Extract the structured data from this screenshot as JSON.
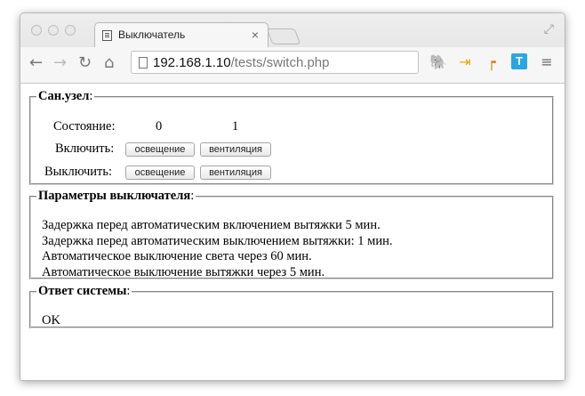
{
  "browser": {
    "tab_title": "Выключатель",
    "tab_close": "×",
    "url_host": "192.168.1.10",
    "url_path": "/tests/switch.php",
    "icons": [
      "back-arrow-icon",
      "forward-arrow-icon",
      "reload-icon",
      "home-icon",
      "evernote-icon",
      "bookmark-arrow-icon",
      "leaf-icon",
      "t-icon",
      "menu-icon"
    ]
  },
  "sanuzel": {
    "legend": "Сан.узел",
    "legend_colon": ":",
    "state_label": "Состояние:",
    "state_values": [
      "0",
      "1"
    ],
    "on_label": "Включить:",
    "off_label": "Выключить:",
    "btn_light": "освещение",
    "btn_vent": "вентиляция"
  },
  "params": {
    "legend": "Параметры выключателя",
    "legend_colon": ":",
    "lines": [
      "Задержка перед автоматическим включением вытяжки 5 мин.",
      "Задержка перед автоматическим выключением вытяжки: 1 мин.",
      "Автоматическое выключение света через 60 мин.",
      "Автоматическое выключение вытяжки через 5 мин."
    ]
  },
  "response": {
    "legend": "Ответ системы",
    "legend_colon": ":",
    "text": "OK"
  }
}
